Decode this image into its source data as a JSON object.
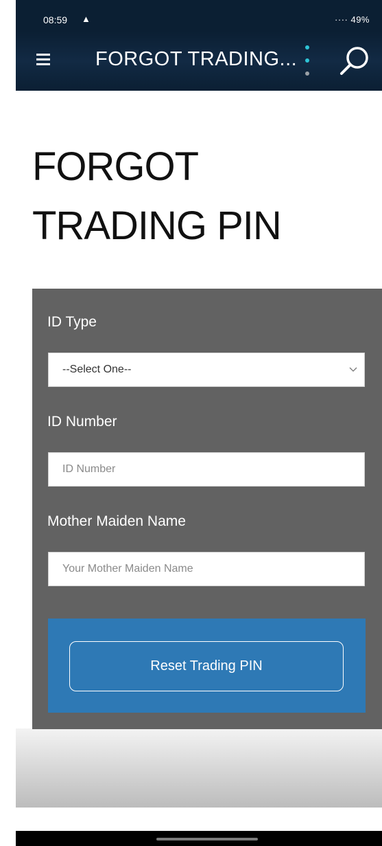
{
  "status_bar": {
    "time": "08:59",
    "warning_icon": "warning-triangle-icon",
    "right_indicators": "···· 49%"
  },
  "app_bar": {
    "title": "FORGOT TRADING...",
    "menu_icon": "hamburger-menu-icon",
    "more_icon": "kebab-menu-icon",
    "search_icon": "search-icon",
    "kebab_dot_colors": [
      "#2ec4d6",
      "#2ec4d6",
      "#9aa0a6"
    ]
  },
  "page": {
    "title_line1": "FORGOT",
    "title_line2": "TRADING PIN"
  },
  "form": {
    "id_type_label": "ID Type",
    "id_type_value": "--Select One--",
    "id_number_label": "ID Number",
    "id_number_placeholder": "ID Number",
    "mother_maiden_label": "Mother Maiden Name",
    "mother_maiden_placeholder": "Your Mother Maiden Name",
    "submit_label": "Reset Trading PIN"
  },
  "colors": {
    "header_bg": "#0b1f33",
    "panel_bg": "#626262",
    "button_bg": "#2e79b5"
  }
}
